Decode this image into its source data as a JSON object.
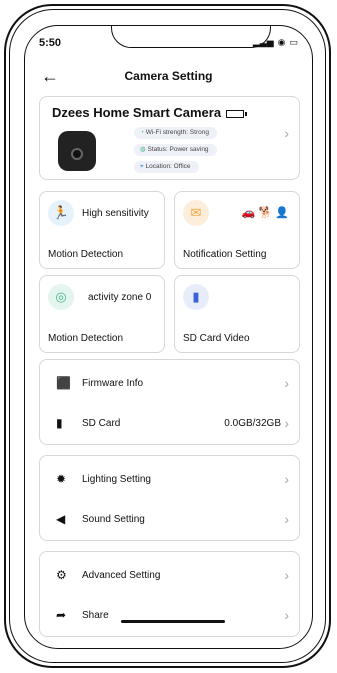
{
  "status": {
    "time": "5:50",
    "signal": "..ll",
    "wifi": "wifi",
    "battery": "battery"
  },
  "header": {
    "back": "←",
    "title": "Camera Setting"
  },
  "device": {
    "name": "Dzees Home Smart Camera",
    "wifi": "Wi-Fi strength: Strong",
    "status": "Status: Power saving",
    "location": "Location: Office"
  },
  "tiles": [
    {
      "main": "High sensitivity",
      "label": "Motion Detection",
      "icon": "running-person-icon"
    },
    {
      "main": "",
      "label": "Notification Setting",
      "icon": "envelope-icon"
    },
    {
      "main": "activity zone 0",
      "label": "Motion Detection",
      "icon": "zone-icon"
    },
    {
      "main": "",
      "label": "SD Card Video",
      "icon": "sd-card-icon"
    }
  ],
  "group1": [
    {
      "label": "Firmware Info",
      "value": "",
      "icon": "chip-icon"
    },
    {
      "label": "SD Card",
      "value": "0.0GB/32GB",
      "icon": "sd-card-icon"
    }
  ],
  "group2": [
    {
      "label": "Lighting Setting",
      "icon": "light-bulb-icon"
    },
    {
      "label": "Sound Setting",
      "icon": "speaker-icon"
    }
  ],
  "group3": [
    {
      "label": "Advanced Setting",
      "icon": "gear-icon"
    },
    {
      "label": "Share",
      "icon": "share-arrow-icon"
    }
  ],
  "colors": {
    "accent_blue": "#2f8fd8",
    "accent_orange": "#f4a03a",
    "accent_green": "#4bb48a"
  }
}
